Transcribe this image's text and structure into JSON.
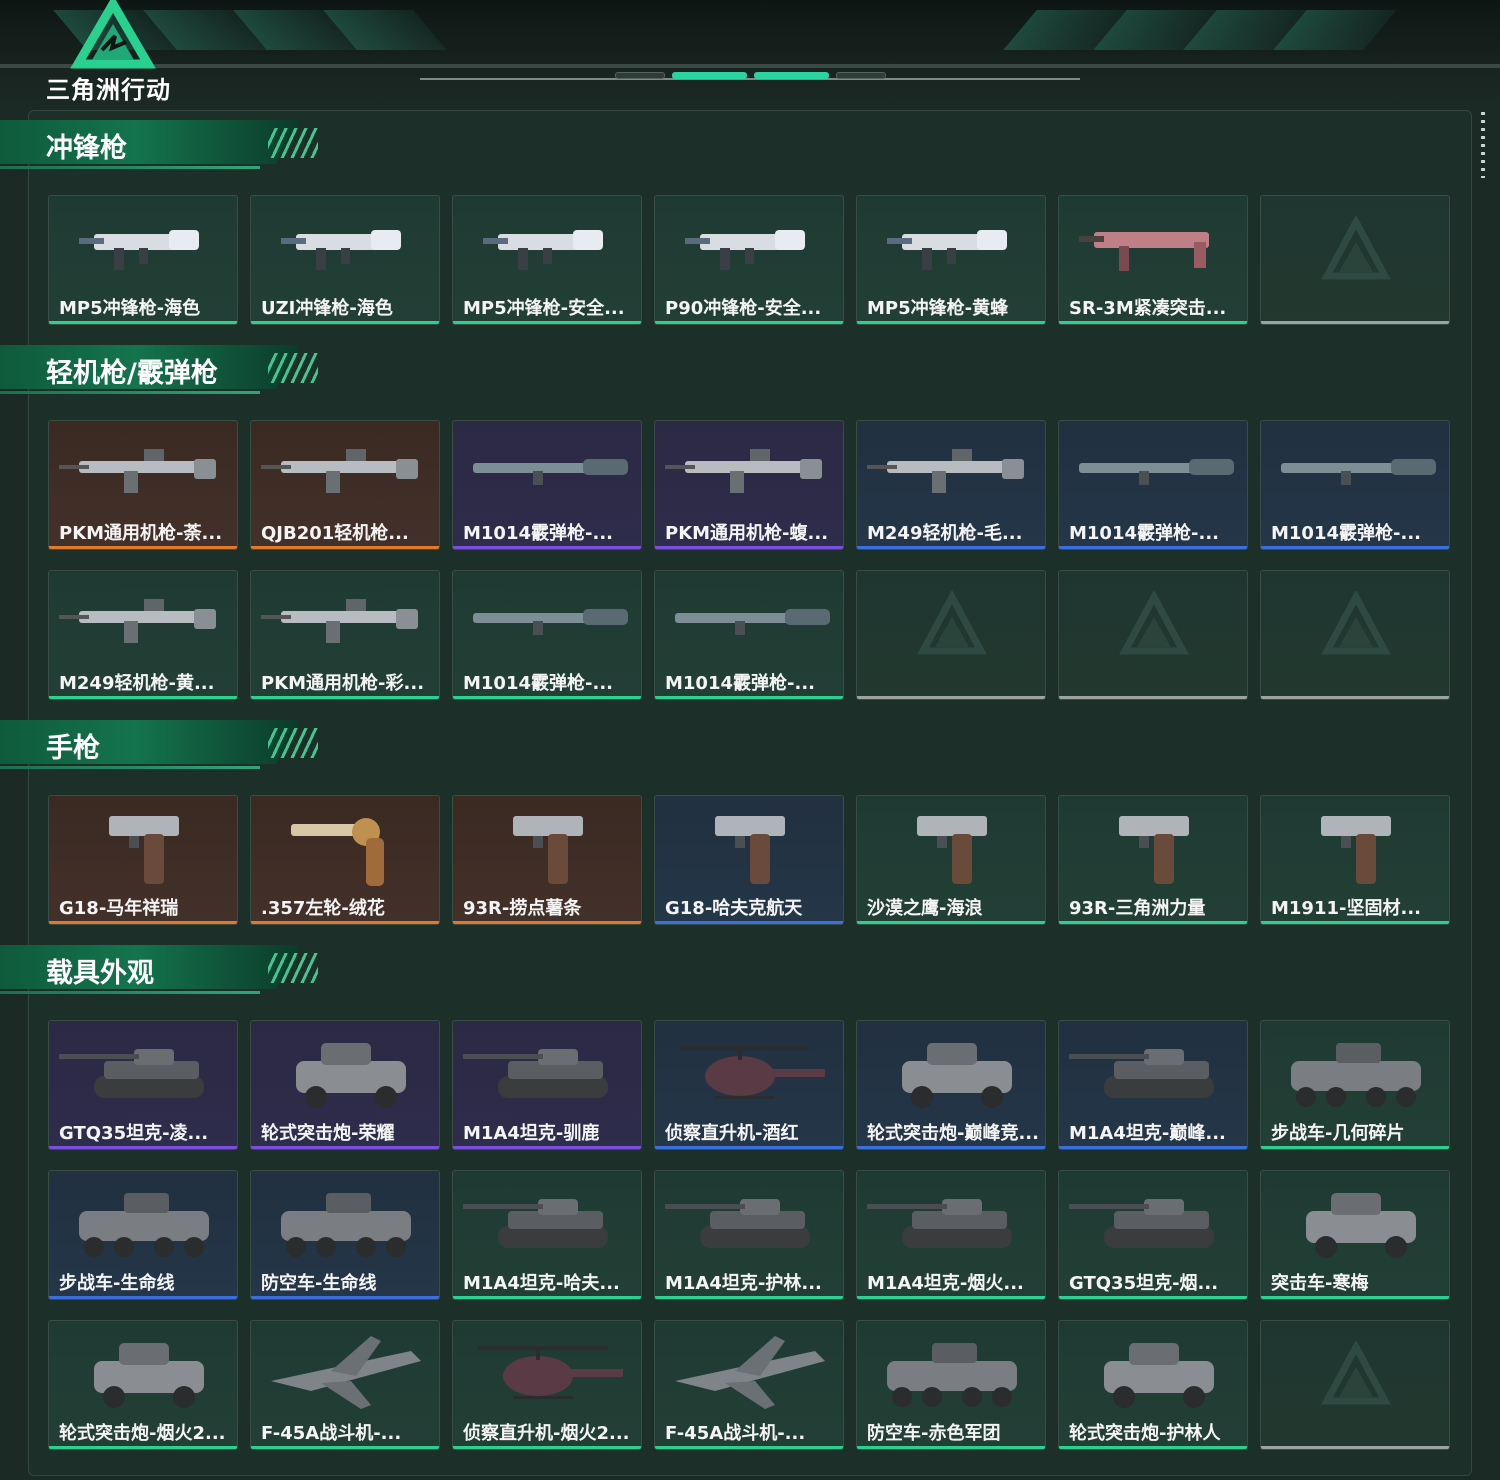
{
  "app": {
    "title": "三角洲行动"
  },
  "theme": {
    "accent": "#2ad08f",
    "rarity_colors": {
      "green": "#2ad08f",
      "orange": "#e07a2a",
      "purple": "#7a4ee0",
      "blue": "#3a6fe0",
      "empty": "#9aa5a1"
    }
  },
  "sections": [
    {
      "title": "冲锋枪",
      "items": [
        {
          "label": "MP5冲锋枪-海色",
          "rarity": "green",
          "icon": "smg-icon"
        },
        {
          "label": "UZI冲锋枪-海色",
          "rarity": "green",
          "icon": "smg-icon"
        },
        {
          "label": "MP5冲锋枪-安全...",
          "rarity": "green",
          "icon": "smg-icon"
        },
        {
          "label": "P90冲锋枪-安全...",
          "rarity": "green",
          "icon": "smg-icon"
        },
        {
          "label": "MP5冲锋枪-黄蜂",
          "rarity": "green",
          "icon": "smg-icon"
        },
        {
          "label": "SR-3M紧凑突击...",
          "rarity": "green",
          "icon": "rifle-icon"
        },
        {
          "label": "",
          "rarity": "empty",
          "icon": "placeholder-logo-icon"
        }
      ]
    },
    {
      "title": "轻机枪/霰弹枪",
      "items": [
        {
          "label": "PKM通用机枪-荼...",
          "rarity": "orange",
          "icon": "machine-gun-icon"
        },
        {
          "label": "QJB201轻机枪...",
          "rarity": "orange",
          "icon": "machine-gun-icon"
        },
        {
          "label": "M1014霰弹枪-...",
          "rarity": "purple",
          "icon": "shotgun-icon"
        },
        {
          "label": "PKM通用机枪-蝮...",
          "rarity": "purple",
          "icon": "machine-gun-icon"
        },
        {
          "label": "M249轻机枪-毛...",
          "rarity": "blue",
          "icon": "machine-gun-icon"
        },
        {
          "label": "M1014霰弹枪-...",
          "rarity": "blue",
          "icon": "shotgun-icon"
        },
        {
          "label": "M1014霰弹枪-...",
          "rarity": "blue",
          "icon": "shotgun-icon"
        },
        {
          "label": "M249轻机枪-黄...",
          "rarity": "green",
          "icon": "machine-gun-icon"
        },
        {
          "label": "PKM通用机枪-彩...",
          "rarity": "green",
          "icon": "machine-gun-icon"
        },
        {
          "label": "M1014霰弹枪-...",
          "rarity": "green",
          "icon": "shotgun-icon"
        },
        {
          "label": "M1014霰弹枪-...",
          "rarity": "green",
          "icon": "shotgun-icon"
        },
        {
          "label": "",
          "rarity": "empty",
          "icon": "placeholder-logo-icon"
        },
        {
          "label": "",
          "rarity": "empty",
          "icon": "placeholder-logo-icon"
        },
        {
          "label": "",
          "rarity": "empty",
          "icon": "placeholder-logo-icon"
        }
      ]
    },
    {
      "title": "手枪",
      "items": [
        {
          "label": "G18-马年祥瑞",
          "rarity": "orange",
          "icon": "pistol-icon"
        },
        {
          "label": ".357左轮-绒花",
          "rarity": "orange",
          "icon": "revolver-icon"
        },
        {
          "label": "93R-捞点薯条",
          "rarity": "orange",
          "icon": "pistol-icon"
        },
        {
          "label": "G18-哈夫克航天",
          "rarity": "blue",
          "icon": "pistol-icon"
        },
        {
          "label": "沙漠之鹰-海浪",
          "rarity": "green",
          "icon": "pistol-icon"
        },
        {
          "label": "93R-三角洲力量",
          "rarity": "green",
          "icon": "pistol-icon"
        },
        {
          "label": "M1911-坚固材...",
          "rarity": "green",
          "icon": "pistol-icon"
        }
      ]
    },
    {
      "title": "载具外观",
      "items": [
        {
          "label": "GTQ35坦克-凌...",
          "rarity": "purple",
          "icon": "tank-icon"
        },
        {
          "label": "轮式突击炮-荣耀",
          "rarity": "purple",
          "icon": "armored-car-icon"
        },
        {
          "label": "M1A4坦克-驯鹿",
          "rarity": "purple",
          "icon": "tank-icon"
        },
        {
          "label": "侦察直升机-酒红",
          "rarity": "blue",
          "icon": "helicopter-icon"
        },
        {
          "label": "轮式突击炮-巅峰竞...",
          "rarity": "blue",
          "icon": "armored-car-icon"
        },
        {
          "label": "M1A4坦克-巅峰...",
          "rarity": "blue",
          "icon": "tank-icon"
        },
        {
          "label": "步战车-几何碎片",
          "rarity": "green",
          "icon": "apc-icon"
        },
        {
          "label": "步战车-生命线",
          "rarity": "blue",
          "icon": "apc-icon"
        },
        {
          "label": "防空车-生命线",
          "rarity": "blue",
          "icon": "apc-icon"
        },
        {
          "label": "M1A4坦克-哈夫...",
          "rarity": "green",
          "icon": "tank-icon"
        },
        {
          "label": "M1A4坦克-护林...",
          "rarity": "green",
          "icon": "tank-icon"
        },
        {
          "label": "M1A4坦克-烟火...",
          "rarity": "green",
          "icon": "tank-icon"
        },
        {
          "label": "GTQ35坦克-烟...",
          "rarity": "green",
          "icon": "tank-icon"
        },
        {
          "label": "突击车-寒梅",
          "rarity": "green",
          "icon": "armored-car-icon"
        },
        {
          "label": "轮式突击炮-烟火2...",
          "rarity": "green",
          "icon": "armored-car-icon"
        },
        {
          "label": "F-45A战斗机-...",
          "rarity": "green",
          "icon": "jet-icon"
        },
        {
          "label": "侦察直升机-烟火2...",
          "rarity": "green",
          "icon": "helicopter-icon"
        },
        {
          "label": "F-45A战斗机-...",
          "rarity": "green",
          "icon": "jet-icon"
        },
        {
          "label": "防空车-赤色军团",
          "rarity": "green",
          "icon": "apc-icon"
        },
        {
          "label": "轮式突击炮-护林人",
          "rarity": "green",
          "icon": "armored-car-icon"
        },
        {
          "label": "",
          "rarity": "empty",
          "icon": "placeholder-logo-icon"
        }
      ]
    }
  ]
}
